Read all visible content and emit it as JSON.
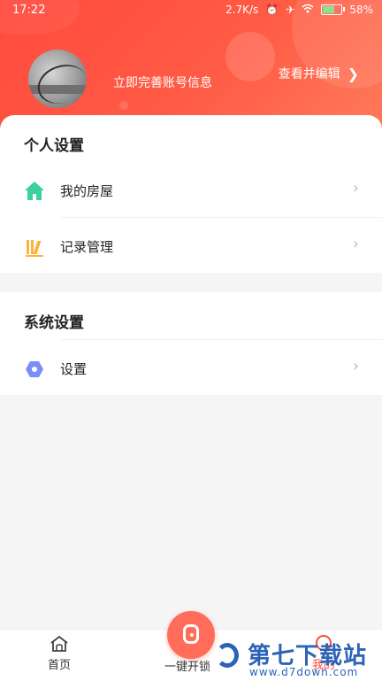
{
  "status_bar": {
    "time": "17:22",
    "speed": "2.7K/s",
    "battery": "58%",
    "battery_level": 0.58
  },
  "header": {
    "complete_info_text": "立即完善账号信息",
    "view_edit_text": "查看并编辑",
    "chevron": "›"
  },
  "personal": {
    "title": "个人设置",
    "items": [
      {
        "label": "我的房屋",
        "icon": "house-icon"
      },
      {
        "label": "记录管理",
        "icon": "books-icon"
      }
    ]
  },
  "system": {
    "title": "系统设置",
    "items": [
      {
        "label": "设置",
        "icon": "hexagon-settings-icon"
      }
    ]
  },
  "tabs": {
    "home": "首页",
    "center": "一键开锁",
    "mine": "我的"
  },
  "watermark": {
    "title": "第七下载站",
    "url": "www.d7down.com"
  },
  "colors": {
    "brand": "#ff4a3d",
    "house": "#3ccfa1",
    "books": "#ffb13b",
    "settings": "#7b8ef5"
  }
}
